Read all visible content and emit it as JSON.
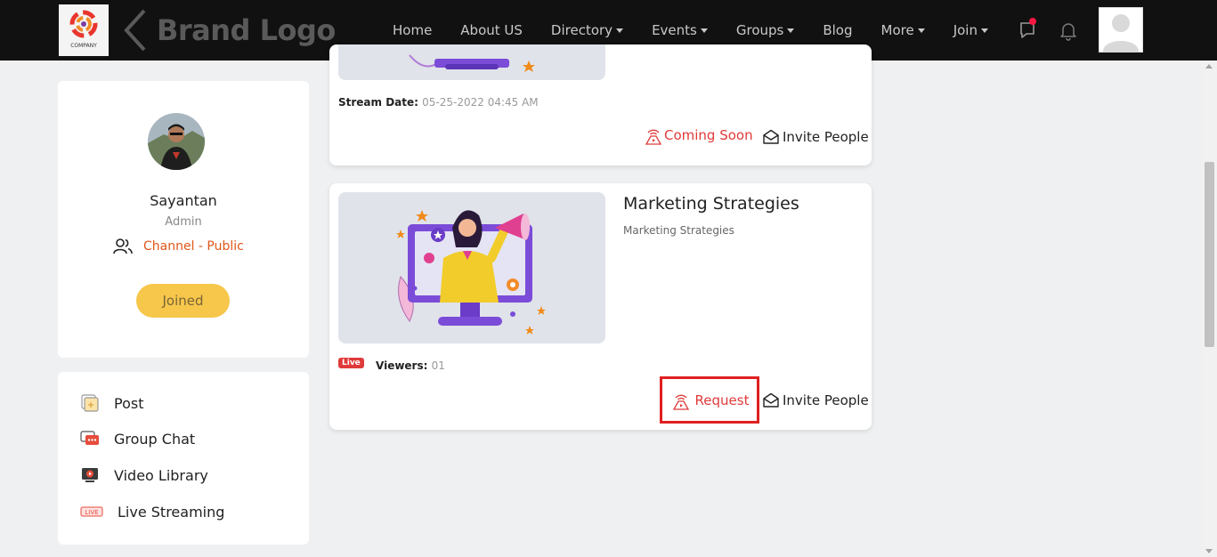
{
  "navbar": {
    "company_logo_text": "COMPANY",
    "brand_text": "Brand Logo",
    "items": [
      {
        "label": "Home",
        "dropdown": false
      },
      {
        "label": "About US",
        "dropdown": false
      },
      {
        "label": "Directory",
        "dropdown": true
      },
      {
        "label": "Events",
        "dropdown": true
      },
      {
        "label": "Groups",
        "dropdown": true
      },
      {
        "label": "Blog",
        "dropdown": false
      },
      {
        "label": "More",
        "dropdown": true
      },
      {
        "label": "Join",
        "dropdown": true
      }
    ],
    "icons": [
      "chat-icon",
      "bell-icon",
      "user-avatar-icon"
    ],
    "notification_dot_color": "#ff1744"
  },
  "profile": {
    "name": "Sayantan",
    "role": "Admin",
    "channel": "Channel - Public",
    "joined_label": "Joined"
  },
  "menu": {
    "items": [
      {
        "label": "Post",
        "icon": "post-icon"
      },
      {
        "label": "Group Chat",
        "icon": "group-chat-icon"
      },
      {
        "label": "Video Library",
        "icon": "video-library-icon"
      },
      {
        "label": "Live Streaming",
        "icon": "live-streaming-icon"
      }
    ]
  },
  "streams": [
    {
      "date_label": "Stream Date:",
      "date_value": "05-25-2022 04:45 AM",
      "status_label": "Coming Soon",
      "invite_label": "Invite People"
    },
    {
      "title": "Marketing Strategies",
      "subtitle": "Marketing Strategies",
      "live_badge": "Live",
      "viewers_label": "Viewers:",
      "viewers_value": "01",
      "request_label": "Request",
      "invite_label": "Invite People"
    }
  ],
  "colors": {
    "accent_red": "#e03a3a",
    "channel_orange": "#e0561a",
    "joined_yellow": "#f6c74b",
    "navbar_bg": "#111111"
  }
}
